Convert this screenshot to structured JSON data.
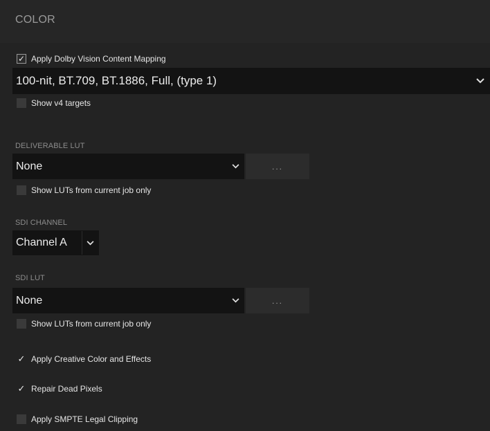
{
  "header": {
    "title": "COLOR"
  },
  "dolby": {
    "apply_label": "Apply Dolby Vision Content Mapping",
    "apply_checked": true,
    "target_value": "100-nit, BT.709, BT.1886, Full, (type 1)",
    "show_v4_label": "Show v4 targets",
    "show_v4_checked": false
  },
  "deliverable_lut": {
    "section_label": "DELIVERABLE LUT",
    "value": "None",
    "browse_label": "...",
    "current_job_label": "Show LUTs from current job only",
    "current_job_checked": false
  },
  "sdi_channel": {
    "section_label": "SDI CHANNEL",
    "value": "Channel A"
  },
  "sdi_lut": {
    "section_label": "SDI LUT",
    "value": "None",
    "browse_label": "...",
    "current_job_label": "Show LUTs from current job only",
    "current_job_checked": false
  },
  "options": {
    "creative_color_label": "Apply Creative Color and Effects",
    "creative_color_checked": true,
    "dead_pixels_label": "Repair Dead Pixels",
    "dead_pixels_checked": true,
    "smpte_clipping_label": "Apply SMPTE Legal Clipping",
    "smpte_clipping_checked": false
  },
  "icons": {
    "check": "check-icon",
    "dropdown": "chevron-down-icon"
  },
  "colors": {
    "background": "#232323",
    "header_background": "#262626",
    "field_background": "#131313",
    "button_background": "#2c2c2c",
    "text": "#e6e6e6",
    "muted_text": "#8c8c8c"
  }
}
